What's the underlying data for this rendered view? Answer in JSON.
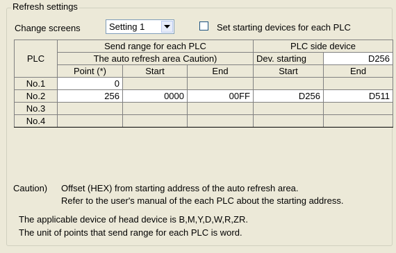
{
  "group_title": "Refresh settings",
  "change_screens": {
    "label": "Change screens",
    "selected": "Setting 1"
  },
  "starting_devices": {
    "label": "Set starting devices for each PLC",
    "checked": false
  },
  "table": {
    "plc_header": "PLC",
    "send_range_header": "Send range for each PLC",
    "auto_refresh_header": "The auto refresh area  Caution)",
    "plc_side_header": "PLC side device",
    "dev_starting_label": "Dev. starting",
    "dev_starting_value": "D256",
    "col_point": "Point (*)",
    "col_start": "Start",
    "col_end": "End",
    "col_side_start": "Start",
    "col_side_end": "End",
    "rows": [
      {
        "plc": "No.1",
        "point": "0",
        "start": "",
        "end": "",
        "side_start": "",
        "side_end": ""
      },
      {
        "plc": "No.2",
        "point": "256",
        "start": "0000",
        "end": "00FF",
        "side_start": "D256",
        "side_end": "D511"
      },
      {
        "plc": "No.3",
        "point": "",
        "start": "",
        "end": "",
        "side_start": "",
        "side_end": ""
      },
      {
        "plc": "No.4",
        "point": "",
        "start": "",
        "end": "",
        "side_start": "",
        "side_end": ""
      }
    ]
  },
  "caution": {
    "label": "Caution)",
    "line1": "Offset (HEX) from starting address of the auto refresh area.",
    "line2": "Refer to the user's manual of the each PLC about the starting address."
  },
  "info": {
    "line1": "The applicable device of head device is B,M,Y,D,W,R,ZR.",
    "line2": "The unit of points that send range for each PLC is word."
  },
  "colors": {
    "cell_white": "#ffffff",
    "cell_gray": "#ece9d8",
    "border": "#808080"
  },
  "icons": {
    "dropdown": "chevron-down-icon"
  }
}
